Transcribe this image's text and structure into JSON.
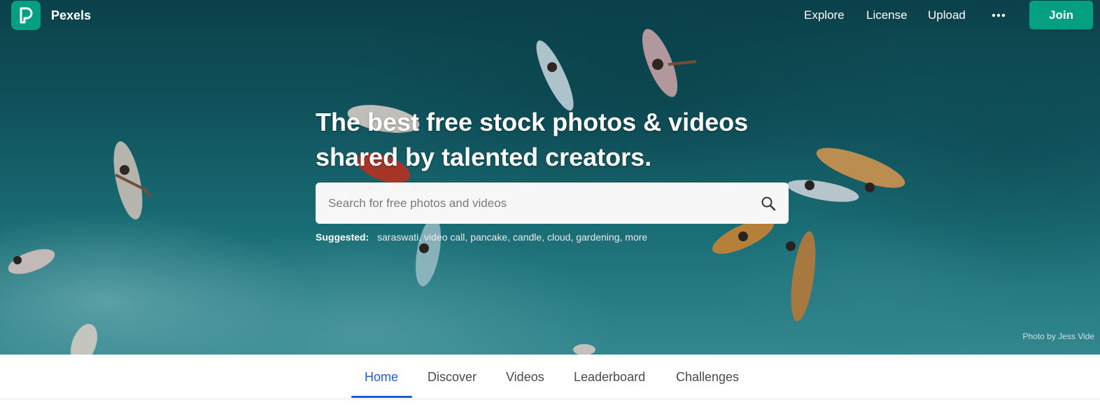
{
  "header": {
    "brand": "Pexels",
    "nav": [
      {
        "label": "Explore"
      },
      {
        "label": "License"
      },
      {
        "label": "Upload"
      }
    ],
    "more_icon": "more-horizontal-icon",
    "join_label": "Join",
    "accent_color": "#05a081"
  },
  "hero": {
    "headline_line1": "The best free stock photos & videos",
    "headline_line2": "shared by talented creators.",
    "search": {
      "placeholder": "Search for free photos and videos",
      "value": "",
      "icon": "search-icon"
    },
    "suggested": {
      "label": "Suggested:",
      "items": [
        "saraswati",
        "video call",
        "pancake",
        "candle",
        "cloud",
        "gardening",
        "more"
      ]
    },
    "credit": "Photo by Jess Vide"
  },
  "tabs": {
    "items": [
      {
        "label": "Home",
        "active": true
      },
      {
        "label": "Discover",
        "active": false
      },
      {
        "label": "Videos",
        "active": false
      },
      {
        "label": "Leaderboard",
        "active": false
      },
      {
        "label": "Challenges",
        "active": false
      }
    ],
    "active_color": "#1e5bd8"
  }
}
